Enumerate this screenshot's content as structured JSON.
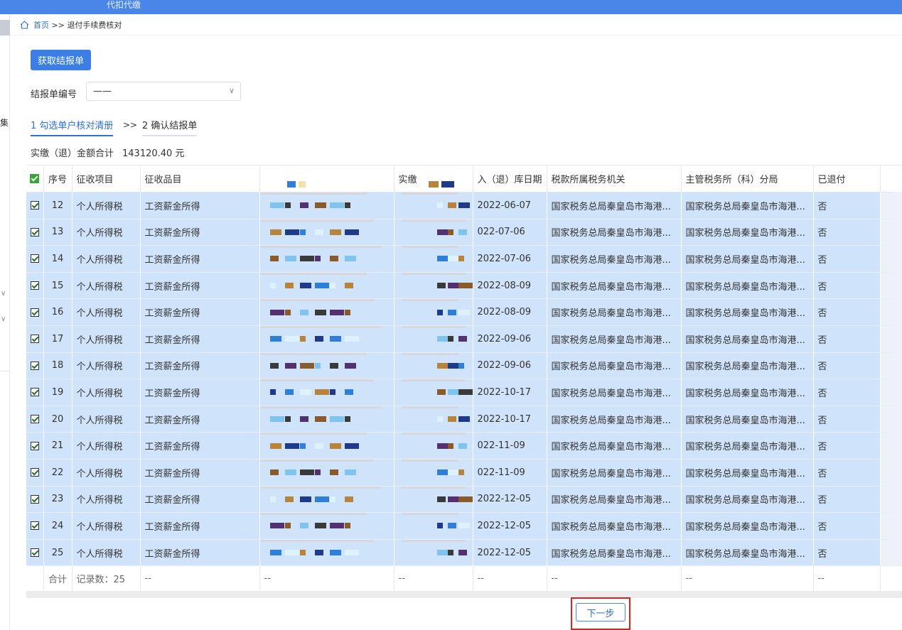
{
  "topbar": {
    "title": "代扣代缴"
  },
  "sidebar": {
    "fragment": "集",
    "chevron": "∨"
  },
  "breadcrumb": {
    "home": "首页",
    "separator": " >> ",
    "current": "退付手续费核对"
  },
  "toolbar": {
    "fetch_label": "获取结报单"
  },
  "filter": {
    "label": "结报单编号",
    "value": "——"
  },
  "steps": [
    {
      "label": "1 勾选单户核对清册"
    },
    {
      "label": "2 确认结报单"
    }
  ],
  "step_separator": ">>",
  "summary": {
    "label": "实缴（退）金额合计",
    "amount": "143120.40 元"
  },
  "table": {
    "columns": [
      "序号",
      "征收项目",
      "征收品目",
      "",
      "实缴",
      "入（退）库日期",
      "税款所属税务机关",
      "主管税务所（科）分局",
      "已退付"
    ],
    "rows": [
      {
        "no": "12",
        "item": "个人所得税",
        "subitem": "工资薪金所得",
        "date": "2022-06-07",
        "org": "国家税务总局秦皇岛市海港...",
        "branch": "国家税务总局秦皇岛市海港...",
        "refunded": "否"
      },
      {
        "no": "13",
        "item": "个人所得税",
        "subitem": "工资薪金所得",
        "date": "022-07-06",
        "org": "国家税务总局秦皇岛市海港...",
        "branch": "国家税务总局秦皇岛市海港...",
        "refunded": "否"
      },
      {
        "no": "14",
        "item": "个人所得税",
        "subitem": "工资薪金所得",
        "date": "2022-07-06",
        "org": "国家税务总局秦皇岛市海港...",
        "branch": "国家税务总局秦皇岛市海港...",
        "refunded": "否"
      },
      {
        "no": "15",
        "item": "个人所得税",
        "subitem": "工资薪金所得",
        "date": "2022-08-09",
        "org": "国家税务总局秦皇岛市海港...",
        "branch": "国家税务总局秦皇岛市海港...",
        "refunded": "否"
      },
      {
        "no": "16",
        "item": "个人所得税",
        "subitem": "工资薪金所得",
        "date": "2022-08-09",
        "org": "国家税务总局秦皇岛市海港...",
        "branch": "国家税务总局秦皇岛市海港...",
        "refunded": "否"
      },
      {
        "no": "17",
        "item": "个人所得税",
        "subitem": "工资薪金所得",
        "date": "2022-09-06",
        "org": "国家税务总局秦皇岛市海港...",
        "branch": "国家税务总局秦皇岛市海港...",
        "refunded": "否"
      },
      {
        "no": "18",
        "item": "个人所得税",
        "subitem": "工资薪金所得",
        "date": "2022-09-06",
        "org": "国家税务总局秦皇岛市海港...",
        "branch": "国家税务总局秦皇岛市海港...",
        "refunded": "否"
      },
      {
        "no": "19",
        "item": "个人所得税",
        "subitem": "工资薪金所得",
        "date": "2022-10-17",
        "org": "国家税务总局秦皇岛市海港...",
        "branch": "国家税务总局秦皇岛市海港...",
        "refunded": "否"
      },
      {
        "no": "20",
        "item": "个人所得税",
        "subitem": "工资薪金所得",
        "date": "2022-10-17",
        "org": "国家税务总局秦皇岛市海港...",
        "branch": "国家税务总局秦皇岛市海港...",
        "refunded": "否"
      },
      {
        "no": "21",
        "item": "个人所得税",
        "subitem": "工资薪金所得",
        "date": "022-11-09",
        "org": "国家税务总局秦皇岛市海港...",
        "branch": "国家税务总局秦皇岛市海港...",
        "refunded": "否"
      },
      {
        "no": "22",
        "item": "个人所得税",
        "subitem": "工资薪金所得",
        "date": "022-11-09",
        "org": "国家税务总局秦皇岛市海港...",
        "branch": "国家税务总局秦皇岛市海港...",
        "refunded": "否"
      },
      {
        "no": "23",
        "item": "个人所得税",
        "subitem": "工资薪金所得",
        "date": "2022-12-05",
        "org": "国家税务总局秦皇岛市海港...",
        "branch": "国家税务总局秦皇岛市海港...",
        "refunded": "否"
      },
      {
        "no": "24",
        "item": "个人所得税",
        "subitem": "工资薪金所得",
        "date": "2022-12-05",
        "org": "国家税务总局秦皇岛市海港...",
        "branch": "国家税务总局秦皇岛市海港...",
        "refunded": "否"
      },
      {
        "no": "25",
        "item": "个人所得税",
        "subitem": "工资薪金所得",
        "date": "2022-12-05",
        "org": "国家税务总局秦皇岛市海港...",
        "branch": "国家税务总局秦皇岛市海港...",
        "refunded": "否"
      }
    ],
    "total": {
      "label": "合计",
      "count": "记录数：25",
      "placeholder": "--"
    }
  },
  "footer": {
    "next_label": "下一步"
  },
  "colors": {
    "accent": "#3a7ee6",
    "row_selected": "#cfe3fb",
    "highlight_border": "#e02020"
  }
}
